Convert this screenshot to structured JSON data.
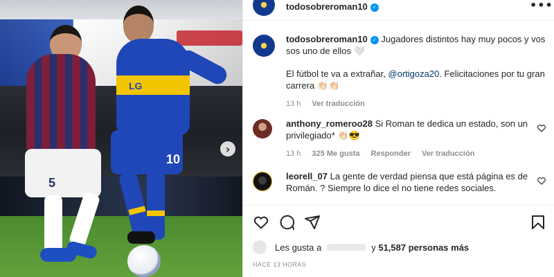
{
  "post": {
    "username": "todosobreroman10",
    "more_label": "•••"
  },
  "caption": {
    "username": "todosobreroman10",
    "line1": "Jugadores distintos hay muy pocos y vos sos uno de ellos 🤍",
    "line2_prefix": "El fútbol te va a extrañar, ",
    "mention": "@ortigoza20",
    "line2_suffix": ". Felicitaciones por tu gran carrera 👏🏻👏🏻",
    "time": "13 h",
    "see_translation": "Ver traducción"
  },
  "comments": [
    {
      "username": "anthony_romeroo28",
      "text": "Si Roman te dedica un estado, son un privilegiado* 👏🏻😎",
      "time": "13 h",
      "likes": "325 Me gusta",
      "reply": "Responder",
      "see_translation": "Ver traducción"
    },
    {
      "username": "leorell_07",
      "text": "La gente de verdad piensa que está página es de Román. ? Siempre lo dice el no tiene redes sociales."
    }
  ],
  "likes": {
    "prefix": "Les gusta a",
    "suffix_y": "y",
    "count": "51,587 personas más"
  },
  "timeago": "HACE 13 HORAS",
  "photo": {
    "sponsor": "LG",
    "numbers": [
      "5",
      "10"
    ]
  },
  "colors": {
    "verified": "#0095f6",
    "mention": "#00376b",
    "boca_blue": "#1f47b8",
    "boca_gold": "#f2c500"
  },
  "icons": [
    "heart-icon",
    "comment-icon",
    "share-icon",
    "bookmark-icon",
    "verified-badge-icon",
    "more-options-icon",
    "carousel-next-icon"
  ]
}
